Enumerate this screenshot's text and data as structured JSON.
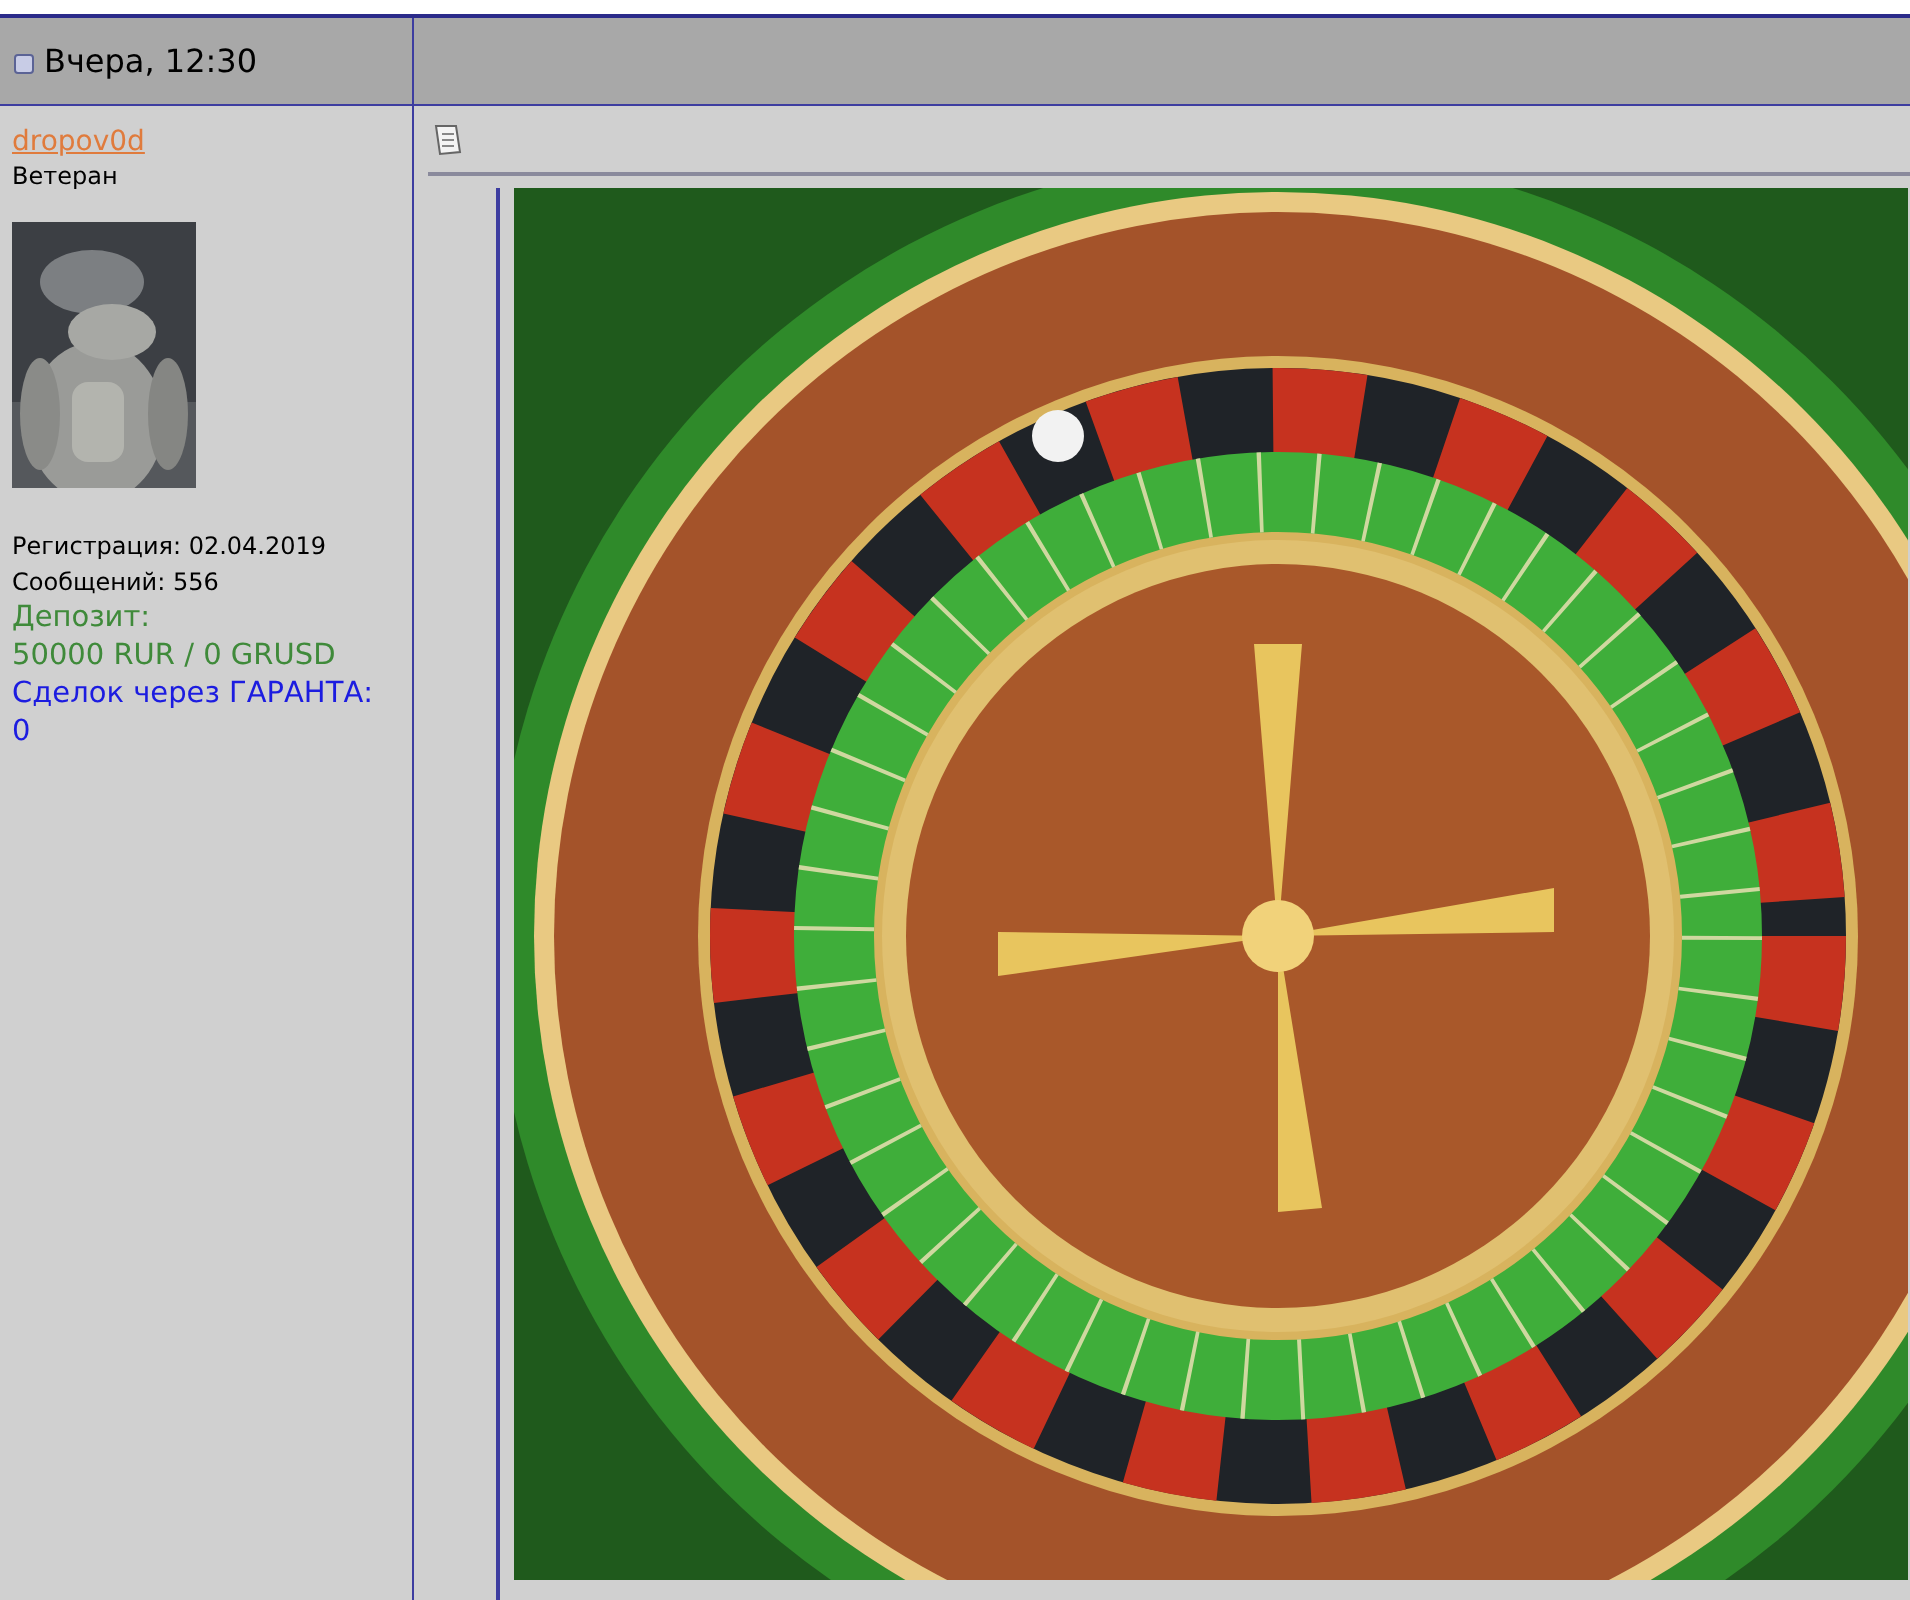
{
  "post": {
    "date": "Вчера, 12:30"
  },
  "author": {
    "username": "dropov0d",
    "rank": "Ветеран",
    "registration": "Регистрация: 02.04.2019",
    "messages": "Сообщений: 556",
    "deposit_label": "Депозит:",
    "deposit_value": "50000 RUR / 0 GRUSD",
    "guarantor_label": "Сделок через ГАРАНТА:",
    "guarantor_value": "0"
  }
}
